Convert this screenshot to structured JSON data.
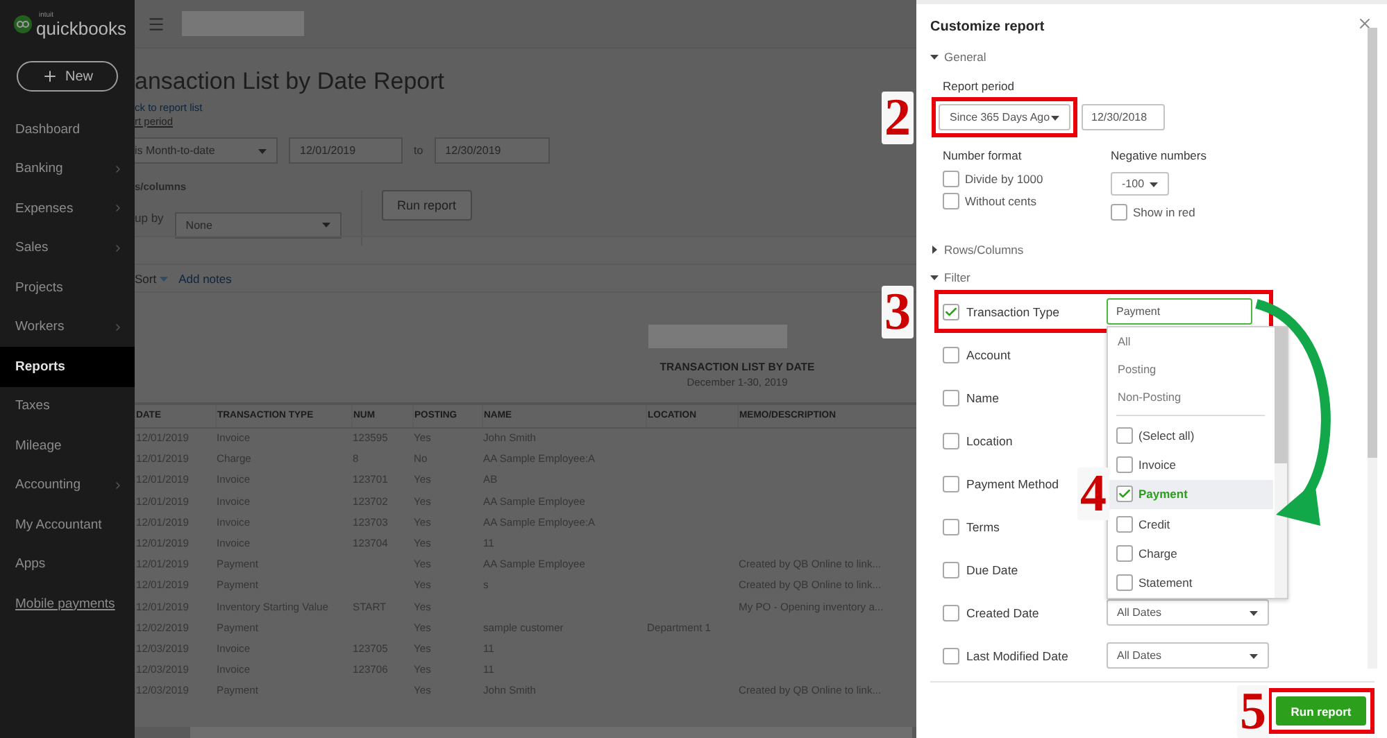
{
  "sidebar": {
    "logo": {
      "maker": "intuit",
      "brand": "quickbooks"
    },
    "new_button": "New",
    "items": [
      {
        "label": "Dashboard",
        "kind": "nav",
        "selected": false,
        "has_submenu": false
      },
      {
        "label": "Banking",
        "kind": "nav",
        "selected": false,
        "has_submenu": true
      },
      {
        "label": "Expenses",
        "kind": "nav",
        "selected": false,
        "has_submenu": true
      },
      {
        "label": "Sales",
        "kind": "nav",
        "selected": false,
        "has_submenu": true
      },
      {
        "label": "Projects",
        "kind": "nav",
        "selected": false,
        "has_submenu": false
      },
      {
        "label": "Workers",
        "kind": "nav",
        "selected": false,
        "has_submenu": true
      },
      {
        "label": "Reports",
        "kind": "nav",
        "selected": true,
        "has_submenu": false
      },
      {
        "label": "Taxes",
        "kind": "nav",
        "selected": false,
        "has_submenu": false
      },
      {
        "label": "Mileage",
        "kind": "nav",
        "selected": false,
        "has_submenu": false
      },
      {
        "label": "Accounting",
        "kind": "nav",
        "selected": false,
        "has_submenu": true
      },
      {
        "label": "My Accountant",
        "kind": "nav",
        "selected": false,
        "has_submenu": false
      },
      {
        "label": "Apps",
        "kind": "nav",
        "selected": false,
        "has_submenu": false
      },
      {
        "label": "Mobile payments",
        "kind": "link",
        "selected": false,
        "has_submenu": false
      }
    ]
  },
  "main": {
    "title": "ansaction List by Date Report",
    "back_link": "ck to report list",
    "report_period_label": "rt period",
    "period_select": "is Month-to-date",
    "date_from": "12/01/2019",
    "to_label": "to",
    "date_to": "12/30/2019",
    "rows_columns_label": "s/columns",
    "group_by_label": "up by",
    "group_by_select": "None",
    "run_report": "Run report",
    "sort": "Sort",
    "add_notes": "Add notes",
    "report": {
      "title": "TRANSACTION LIST BY DATE",
      "subtitle": "December 1-30, 2019",
      "columns": [
        "DATE",
        "TRANSACTION TYPE",
        "NUM",
        "POSTING",
        "NAME",
        "LOCATION",
        "MEMO/DESCRIPTION"
      ],
      "rows": [
        {
          "date": "12/01/2019",
          "type": "Invoice",
          "num": "123595",
          "posting": "Yes",
          "name": "John Smith"
        },
        {
          "date": "12/01/2019",
          "type": "Charge",
          "num": "8",
          "posting": "No",
          "name": "AA Sample Employee:A"
        },
        {
          "date": "12/01/2019",
          "type": "Invoice",
          "num": "123701",
          "posting": "Yes",
          "name": "AB"
        },
        {
          "date": "12/01/2019",
          "type": "Invoice",
          "num": "123702",
          "posting": "Yes",
          "name": "AA Sample Employee"
        },
        {
          "date": "12/01/2019",
          "type": "Invoice",
          "num": "123703",
          "posting": "Yes",
          "name": "AA Sample Employee:A"
        },
        {
          "date": "12/01/2019",
          "type": "Invoice",
          "num": "123704",
          "posting": "Yes",
          "name": "11"
        },
        {
          "date": "12/01/2019",
          "type": "Payment",
          "posting": "Yes",
          "name": "AA Sample Employee",
          "memo": "Created by QB Online to link..."
        },
        {
          "date": "12/01/2019",
          "type": "Payment",
          "posting": "Yes",
          "name": "s",
          "memo": "Created by QB Online to link..."
        },
        {
          "date": "12/01/2019",
          "type": "Inventory Starting Value",
          "num": "START",
          "posting": "Yes",
          "memo": "My PO - Opening inventory a..."
        },
        {
          "date": "12/02/2019",
          "type": "Payment",
          "posting": "Yes",
          "name": "sample customer",
          "location": "Department 1"
        },
        {
          "date": "12/03/2019",
          "type": "Invoice",
          "num": "123705",
          "posting": "Yes",
          "name": "11"
        },
        {
          "date": "12/03/2019",
          "type": "Invoice",
          "num": "123706",
          "posting": "Yes",
          "name": "11"
        },
        {
          "date": "12/03/2019",
          "type": "Payment",
          "posting": "Yes",
          "name": "John Smith",
          "memo": "Created by QB Online to link..."
        }
      ]
    }
  },
  "customize": {
    "title": "Customize report",
    "general": {
      "heading": "General",
      "expanded": true,
      "report_period_label": "Report period",
      "period_select": {
        "value": "Since 365 Days Ago",
        "highlighted": true,
        "step": "2"
      },
      "period_date": "12/30/2018",
      "number_format_label": "Number format",
      "number_options": [
        {
          "label": "Divide by 1000",
          "checked": false
        },
        {
          "label": "Without cents",
          "checked": false
        }
      ],
      "negative_label": "Negative numbers",
      "negative_select": "-100",
      "show_in_red": {
        "label": "Show in red",
        "checked": false
      }
    },
    "rows_columns": {
      "heading": "Rows/Columns",
      "expanded": false
    },
    "filter": {
      "heading": "Filter",
      "expanded": true,
      "items": [
        {
          "label": "Transaction Type",
          "checked": true,
          "highlighted": true,
          "step": "3",
          "field": "Payment"
        },
        {
          "label": "Account",
          "checked": false,
          "highlighted": false
        },
        {
          "label": "Name",
          "checked": false,
          "highlighted": false
        },
        {
          "label": "Location",
          "checked": false,
          "highlighted": false
        },
        {
          "label": "Payment Method",
          "checked": false,
          "highlighted": false
        },
        {
          "label": "Terms",
          "checked": false,
          "highlighted": false
        },
        {
          "label": "Due Date",
          "checked": false,
          "highlighted": false
        },
        {
          "label": "Created Date",
          "checked": false,
          "highlighted": false,
          "select": "All Dates"
        },
        {
          "label": "Last Modified Date",
          "checked": false,
          "highlighted": false,
          "select": "All Dates"
        }
      ],
      "dropdown": {
        "options": [
          "All",
          "Posting",
          "Non-Posting"
        ],
        "types": [
          {
            "label": "(Select all)",
            "checked": false,
            "selected": false
          },
          {
            "label": "Invoice",
            "checked": false,
            "selected": false
          },
          {
            "label": "Payment",
            "checked": true,
            "selected": true,
            "step": "4"
          },
          {
            "label": "Credit",
            "checked": false,
            "selected": false
          },
          {
            "label": "Charge",
            "checked": false,
            "selected": false
          },
          {
            "label": "Statement",
            "checked": false,
            "selected": false
          }
        ]
      }
    },
    "run_report": {
      "label": "Run report",
      "highlighted": true,
      "step": "5"
    }
  }
}
